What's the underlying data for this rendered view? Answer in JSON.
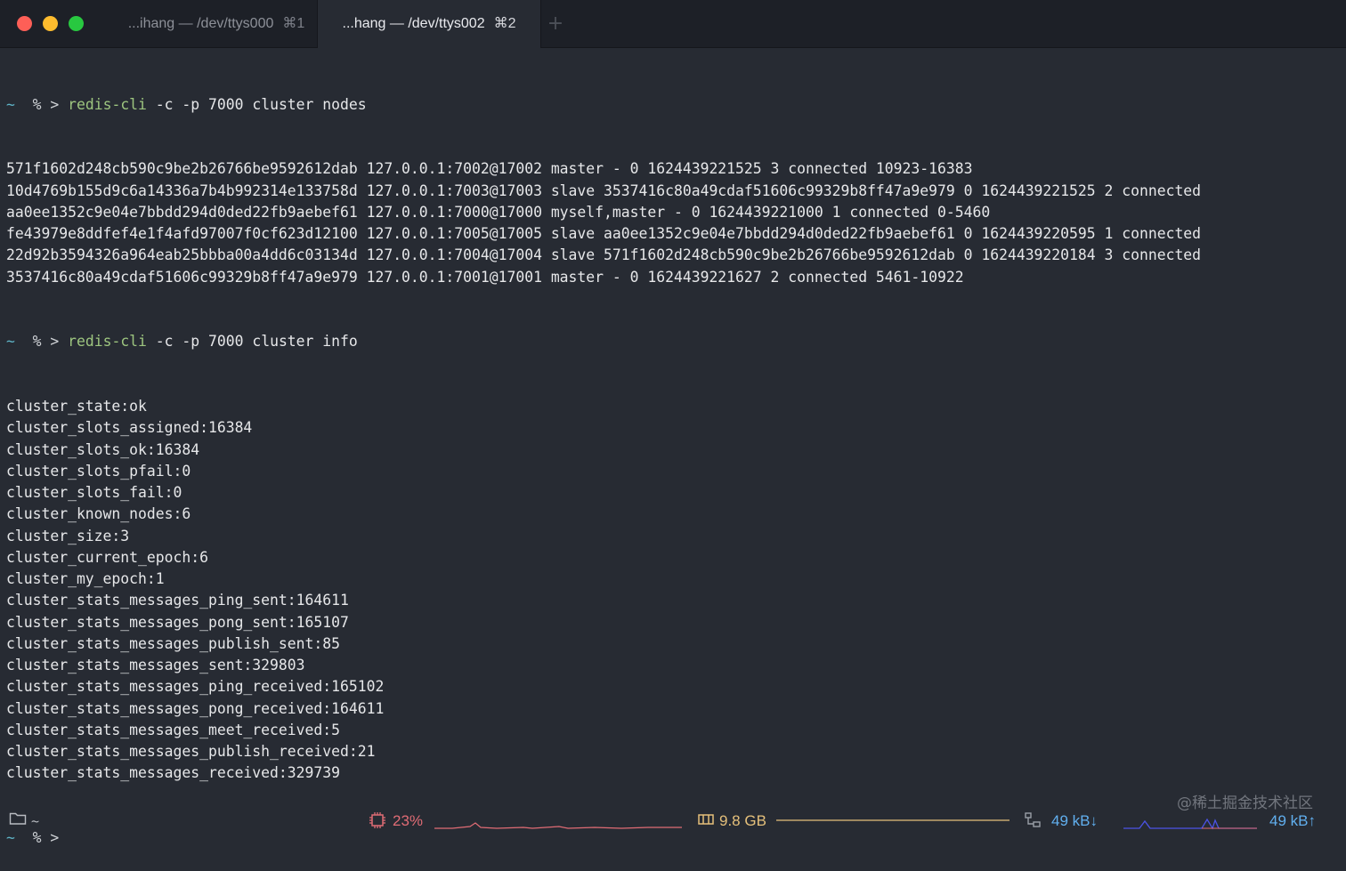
{
  "window": {
    "tabs": [
      {
        "title": "...ihang — /dev/ttys000",
        "shortcut": "⌘1",
        "active": false
      },
      {
        "title": "...hang — /dev/ttys002",
        "shortcut": "⌘2",
        "active": true
      }
    ],
    "new_tab_label": "+"
  },
  "terminal": {
    "prompt": {
      "dir": "~",
      "symbol": "% >"
    },
    "command1": {
      "program": "redis-cli",
      "args": " -c -p 7000 cluster nodes"
    },
    "nodes_output": [
      "571f1602d248cb590c9be2b26766be9592612dab 127.0.0.1:7002@17002 master - 0 1624439221525 3 connected 10923-16383",
      "10d4769b155d9c6a14336a7b4b992314e133758d 127.0.0.1:7003@17003 slave 3537416c80a49cdaf51606c99329b8ff47a9e979 0 1624439221525 2 connected",
      "aa0ee1352c9e04e7bbdd294d0ded22fb9aebef61 127.0.0.1:7000@17000 myself,master - 0 1624439221000 1 connected 0-5460",
      "fe43979e8ddfef4e1f4afd97007f0cf623d12100 127.0.0.1:7005@17005 slave aa0ee1352c9e04e7bbdd294d0ded22fb9aebef61 0 1624439220595 1 connected",
      "22d92b3594326a964eab25bbba00a4dd6c03134d 127.0.0.1:7004@17004 slave 571f1602d248cb590c9be2b26766be9592612dab 0 1624439220184 3 connected",
      "3537416c80a49cdaf51606c99329b8ff47a9e979 127.0.0.1:7001@17001 master - 0 1624439221627 2 connected 5461-10922"
    ],
    "command2": {
      "program": "redis-cli",
      "args": " -c -p 7000 cluster info"
    },
    "info_output": [
      "cluster_state:ok",
      "cluster_slots_assigned:16384",
      "cluster_slots_ok:16384",
      "cluster_slots_pfail:0",
      "cluster_slots_fail:0",
      "cluster_known_nodes:6",
      "cluster_size:3",
      "cluster_current_epoch:6",
      "cluster_my_epoch:1",
      "cluster_stats_messages_ping_sent:164611",
      "cluster_stats_messages_pong_sent:165107",
      "cluster_stats_messages_publish_sent:85",
      "cluster_stats_messages_sent:329803",
      "cluster_stats_messages_ping_received:165102",
      "cluster_stats_messages_pong_received:164611",
      "cluster_stats_messages_meet_received:5",
      "cluster_stats_messages_publish_received:21",
      "cluster_stats_messages_received:329739"
    ]
  },
  "statusbar": {
    "cwd": "~",
    "cpu": "23%",
    "memory": "9.8 GB",
    "net_down": "49 kB↓",
    "net_up": "49 kB↑",
    "icons": {
      "folder": "folder-icon",
      "cpu": "cpu-chip-icon",
      "memory": "memory-icon",
      "network": "network-icon"
    }
  },
  "watermark": "@稀土掘金技术社区",
  "colors": {
    "background": "#272b33",
    "titlebar": "#1d2027",
    "prompt_tilde": "#5fb4c7",
    "command": "#9dc57f",
    "cpu": "#e06c75",
    "memory": "#e5c07b",
    "network": "#61afef"
  }
}
